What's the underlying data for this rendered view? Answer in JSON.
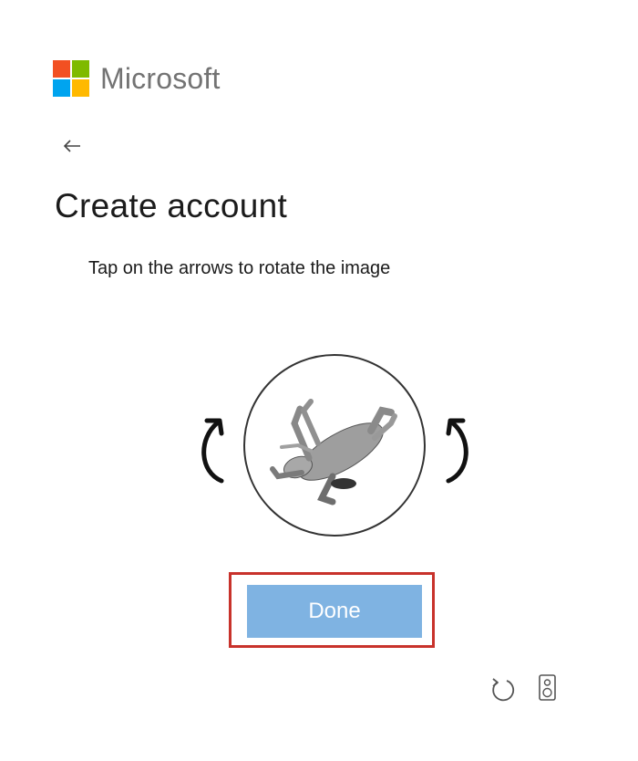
{
  "brand": {
    "name": "Microsoft",
    "logo_colors": [
      "#f25022",
      "#7fba00",
      "#00a4ef",
      "#ffb900"
    ]
  },
  "header": {
    "back_icon": "arrow-left-icon"
  },
  "page": {
    "title": "Create account",
    "instruction": "Tap on the arrows to rotate the image"
  },
  "puzzle": {
    "rotate_left_icon": "rotate-counterclockwise-icon",
    "rotate_right_icon": "rotate-clockwise-icon",
    "image_subject": "animal figure rotated"
  },
  "actions": {
    "done_label": "Done",
    "done_color": "#7fb3e2",
    "highlight_color": "#c8322b"
  },
  "footer": {
    "refresh_icon": "refresh-icon",
    "audio_icon": "speaker-icon"
  }
}
